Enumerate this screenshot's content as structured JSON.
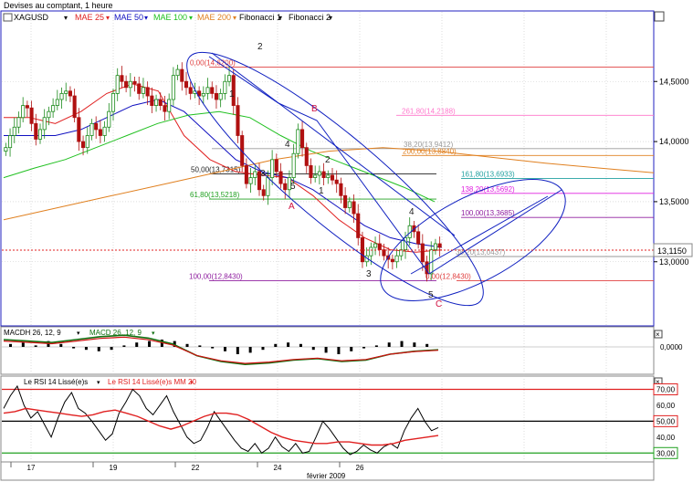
{
  "header": {
    "title": "Devises au comptant, 1 heure"
  },
  "colors": {
    "bull": "#1a8a1a",
    "bear": "#b01010",
    "mae25": "#e02020",
    "mae50": "#1010c0",
    "mae100": "#20c020",
    "mae200": "#e08020",
    "fib_line_red": "#e04040",
    "fib_line_pink": "#ff77cc",
    "fib_line_gray": "#9a9a9a",
    "fib_line_orange": "#e08020",
    "fib_line_teal": "#20a0a0",
    "fib_line_magenta": "#e020e0",
    "fib_line_violet": "#9020a0",
    "fib_line_green": "#20a020",
    "fib_line_black": "#202020",
    "fib_line_darkgreen": "#107010",
    "ellipse": "#1020c0",
    "wave": "#202020",
    "wave_letter": "#d01040",
    "price_line": "#e02020",
    "rsi_line": "#000000",
    "rsi_ma": "#e02020",
    "macd_hist": "#000000",
    "macd_line": "#107010",
    "macd_signal": "#d01010",
    "level70": "#e02020",
    "level30": "#20a020"
  },
  "main_legend": {
    "instrument": "XAGUSD",
    "ma25": "MAE 25",
    "ma50": "MAE 50",
    "ma100": "MAE 100",
    "ma200": "MAE 200",
    "fib1": "Fibonacci 1",
    "fib2": "Fibonacci 2"
  },
  "macd_legend": {
    "hist": "MACDH 26, 12, 9",
    "line": "MACD 26, 12, 9"
  },
  "rsi_legend": {
    "rsi": "Le RSI 14 Lissé(e)s",
    "ma": "Le RSI 14 Lissé(e)s MM 20"
  },
  "price_tag": "13,1150",
  "x_axis": {
    "labels": [
      "17",
      "19",
      "22",
      "24",
      "26"
    ],
    "month_label": "février 2009"
  },
  "fib_labels": [
    {
      "text": "0,00(14,6200)",
      "color": "#e04040",
      "value": 14.62
    },
    {
      "text": "261,80(14,2188)",
      "color": "#ff77cc",
      "value": 14.2188
    },
    {
      "text": "38,20(13,9412)",
      "color": "#9a9a9a",
      "value": 13.9412
    },
    {
      "text": "200,00(13,8840)",
      "color": "#e08020",
      "value": 13.884
    },
    {
      "text": "50,00(13,7315)",
      "color": "#202020",
      "value": 13.7315
    },
    {
      "text": "161,80(13,6933)",
      "color": "#20a0a0",
      "value": 13.6933
    },
    {
      "text": "138,20(13,5692)",
      "color": "#e020e0",
      "value": 13.5692
    },
    {
      "text": "61,80(13,5218)",
      "color": "#20a020",
      "value": 13.5218
    },
    {
      "text": "100,00(13,3685)",
      "color": "#9020a0",
      "value": 13.3685
    },
    {
      "text": "38,20(13,0437)",
      "color": "#9a9a9a",
      "value": 13.0437
    },
    {
      "text": "100,00(12,8430)",
      "color": "#9020a0",
      "value": 12.843
    },
    {
      "text": "0,00(12,8430)",
      "color": "#e04040",
      "value": 12.843
    }
  ],
  "wave_labels": [
    "2",
    "1",
    "B",
    "4",
    "3",
    "5",
    "1",
    "2",
    "A",
    "4",
    "3",
    "5",
    "C"
  ],
  "chart_data": [
    {
      "type": "candlestick",
      "title": "Devises au comptant, 1 heure",
      "instrument": "XAGUSD",
      "price_axis": {
        "ticks": [
          "14,5000",
          "14,0000",
          "13,5000",
          "13,0000"
        ],
        "tick_values": [
          14.5,
          14.0,
          13.5,
          13.0
        ],
        "range": [
          12.55,
          14.95
        ]
      },
      "x_ticks": [
        "17",
        "19",
        "22",
        "24",
        "26"
      ],
      "x_sublabel": "février 2009",
      "last_price": 13.115,
      "close_path": [
        13.95,
        14.05,
        14.12,
        14.2,
        14.3,
        14.28,
        14.15,
        14.02,
        14.1,
        14.2,
        14.25,
        14.3,
        14.35,
        14.4,
        14.42,
        14.38,
        14.2,
        14.0,
        13.95,
        14.05,
        14.15,
        14.1,
        14.05,
        14.12,
        14.25,
        14.4,
        14.55,
        14.5,
        14.45,
        14.5,
        14.48,
        14.4,
        14.45,
        14.38,
        14.3,
        14.35,
        14.3,
        14.25,
        14.35,
        14.55,
        14.6,
        14.5,
        14.45,
        14.4,
        14.42,
        14.38,
        14.4,
        14.45,
        14.4,
        14.35,
        14.4,
        14.5,
        14.55,
        14.3,
        14.05,
        13.8,
        13.65,
        13.7,
        13.75,
        13.6,
        13.55,
        13.7,
        13.85,
        13.75,
        13.65,
        13.6,
        13.7,
        13.9,
        14.1,
        13.95,
        13.8,
        13.7,
        13.72,
        13.75,
        13.7,
        13.72,
        13.68,
        13.65,
        13.55,
        13.45,
        13.5,
        13.4,
        13.2,
        13.0,
        13.05,
        13.12,
        13.15,
        13.1,
        13.05,
        13.02,
        13.0,
        13.05,
        13.1,
        13.2,
        13.3,
        13.25,
        13.15,
        13.0,
        12.9,
        13.1,
        13.15,
        13.12
      ],
      "series": [
        {
          "name": "MAE 25",
          "values": [
            14.2,
            14.2,
            14.15,
            14.25,
            14.4,
            14.48,
            14.42,
            14.05,
            13.85,
            13.75,
            13.72,
            13.7,
            13.55,
            13.35,
            13.2,
            13.1,
            13.08,
            13.1
          ]
        },
        {
          "name": "MAE 50",
          "values": [
            14.05,
            14.05,
            14.05,
            14.1,
            14.2,
            14.3,
            14.35,
            14.25,
            14.05,
            13.85,
            13.75,
            13.7,
            13.6,
            13.45,
            13.3,
            13.2,
            13.15,
            13.12
          ]
        },
        {
          "name": "MAE 100",
          "values": [
            13.7,
            13.78,
            13.85,
            13.95,
            14.05,
            14.15,
            14.22,
            14.25,
            14.2,
            14.05,
            13.92,
            13.82,
            13.72,
            13.62,
            13.5
          ]
        },
        {
          "name": "MAE 200",
          "values": [
            13.35,
            13.45,
            13.55,
            13.65,
            13.75,
            13.85,
            13.92,
            13.95,
            13.92,
            13.87,
            13.82,
            13.78,
            13.74
          ]
        }
      ]
    },
    {
      "type": "bar",
      "title": "MACD",
      "y_ticks": [
        "0,0000"
      ],
      "series": [
        {
          "name": "MACDH 26, 12, 9",
          "values": [
            0.02,
            0.03,
            0.01,
            0.04,
            0.02,
            -0.01,
            -0.02,
            -0.03,
            -0.02,
            0.01,
            0.03,
            0.04,
            0.05,
            0.04,
            0.02,
            0.01,
            -0.01,
            -0.03,
            -0.05,
            -0.04,
            -0.02,
            0.02,
            0.03,
            0.02,
            -0.02,
            -0.04,
            -0.05,
            -0.03,
            -0.01,
            0.01,
            0.03,
            0.04,
            0.03,
            0.02
          ]
        },
        {
          "name": "MACD 26, 12, 9",
          "values": [
            0.05,
            0.04,
            0.03,
            0.05,
            0.07,
            0.08,
            0.06,
            0.02,
            -0.06,
            -0.1,
            -0.12,
            -0.11,
            -0.09,
            -0.08,
            -0.1,
            -0.09,
            -0.05,
            -0.03,
            -0.02
          ]
        }
      ]
    },
    {
      "type": "line",
      "title": "RSI",
      "y_ticks": [
        "70,00",
        "60,00",
        "50,00",
        "40,00",
        "30,00"
      ],
      "y_tick_values": [
        70,
        60,
        50,
        40,
        30
      ],
      "ylim": [
        25,
        76
      ],
      "levels": [
        70,
        50,
        30
      ],
      "series": [
        {
          "name": "Le RSI 14 Lissé(e)s",
          "values": [
            58,
            66,
            72,
            60,
            52,
            56,
            48,
            40,
            52,
            62,
            68,
            58,
            55,
            50,
            44,
            38,
            42,
            55,
            62,
            70,
            66,
            58,
            54,
            60,
            66,
            56,
            48,
            40,
            36,
            38,
            46,
            56,
            50,
            44,
            38,
            33,
            31,
            36,
            30,
            33,
            40,
            34,
            31,
            36,
            30,
            31,
            40,
            50,
            45,
            39,
            33,
            29,
            31,
            35,
            32,
            30,
            34,
            36,
            33,
            44,
            52,
            58,
            50,
            44,
            46
          ]
        },
        {
          "name": "Le RSI 14 Lissé(e)s MM 20",
          "values": [
            55,
            56,
            58,
            57,
            56,
            55,
            54,
            53,
            54,
            56,
            57,
            55,
            53,
            50,
            47,
            45,
            47,
            50,
            53,
            55,
            55,
            54,
            51,
            47,
            43,
            40,
            38,
            37,
            36,
            36,
            37,
            37,
            36,
            35,
            35,
            36,
            38,
            39,
            40,
            41
          ]
        }
      ]
    }
  ]
}
